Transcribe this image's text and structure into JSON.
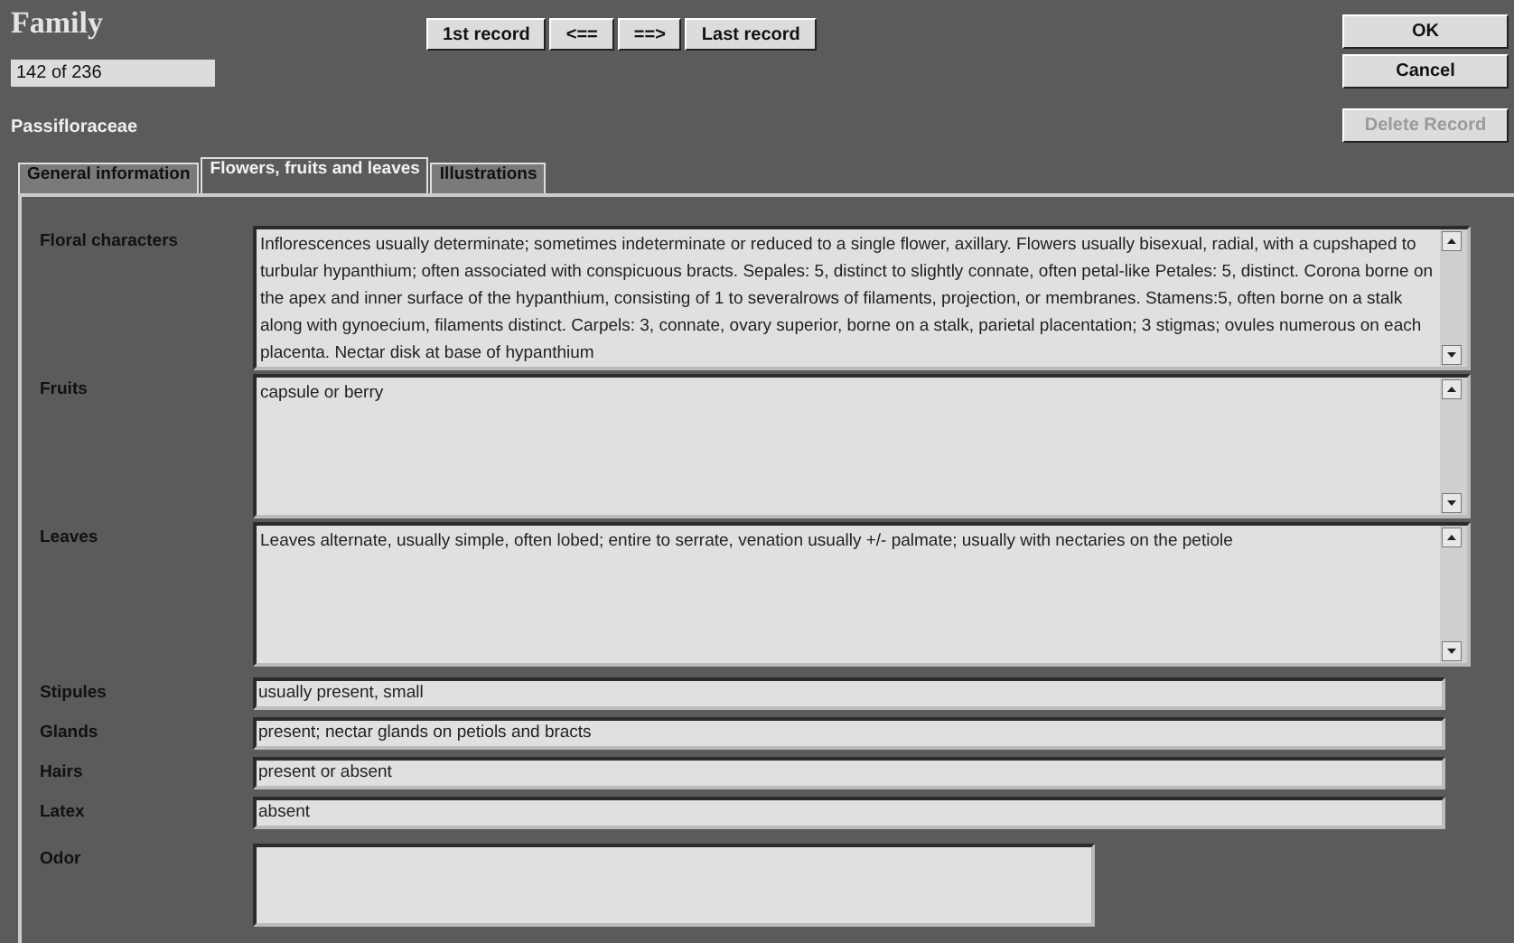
{
  "window": {
    "title": "Family"
  },
  "record_counter": "142 of 236",
  "family_name": "Passifloraceae",
  "nav_buttons": [
    {
      "label": "1st record"
    },
    {
      "label": "<=="
    },
    {
      "label": "==>"
    },
    {
      "label": "Last record"
    }
  ],
  "action_buttons": [
    {
      "label": "OK",
      "disabled": false
    },
    {
      "label": "Cancel",
      "disabled": false
    },
    {
      "label": "Delete Record",
      "disabled": true
    }
  ],
  "tabs": [
    {
      "label": "General information",
      "selected": false
    },
    {
      "label": "Flowers, fruits and leaves",
      "selected": true
    },
    {
      "label": "Illustrations",
      "selected": false
    }
  ],
  "fields": [
    {
      "label": "Floral characters",
      "kind": "memo",
      "value": "Inflorescences usually determinate; sometimes indeterminate or reduced to a single flower, axillary. Flowers usually bisexual, radial, with a cupshaped to turbular hypanthium; often associated with conspicuous bracts. Sepales: 5, distinct to slightly connate, often petal-like Petales: 5, distinct. Corona borne on the apex and inner surface of the hypanthium, consisting of 1 to severalrows of filaments, projection, or membranes. Stamens:5, often borne on a stalk along with gynoecium, filaments distinct. Carpels: 3, connate, ovary superior, borne on a stalk, parietal placentation; 3 stigmas; ovules numerous on each placenta. Nectar disk at base of hypanthium"
    },
    {
      "label": "Fruits",
      "kind": "memo",
      "value": "capsule or berry"
    },
    {
      "label": "Leaves",
      "kind": "memo",
      "value": "Leaves alternate,  usually simple, often lobed; entire to serrate, venation usually +/- palmate; usually with nectaries on the petiole"
    },
    {
      "label": "Stipules",
      "kind": "line",
      "value": "usually present, small"
    },
    {
      "label": "Glands",
      "kind": "line",
      "value": "present; nectar glands on petiols and bracts"
    },
    {
      "label": "Hairs",
      "kind": "line",
      "value": "present or absent"
    },
    {
      "label": "Latex",
      "kind": "line",
      "value": "absent"
    },
    {
      "label": "Odor",
      "kind": "box"
    }
  ]
}
